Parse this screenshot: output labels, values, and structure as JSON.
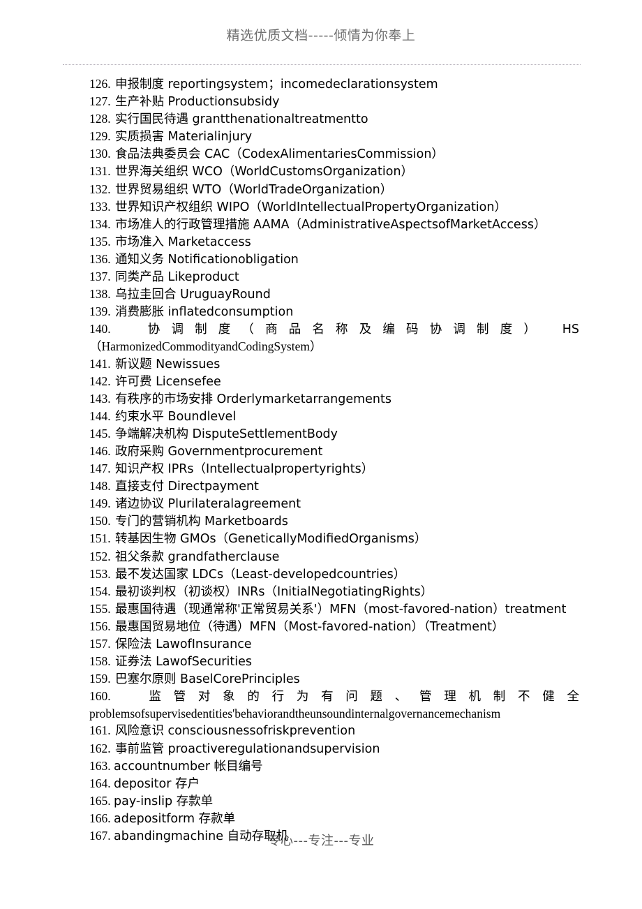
{
  "header": {
    "watermark": "精选优质文档-----倾情为你奉上"
  },
  "footer": {
    "watermark": "专心---专注---专业"
  },
  "glossary": {
    "items": [
      {
        "num": "126.",
        "text": "申报制度 reportingsystem；incomedeclarationsystem",
        "layout": "simple"
      },
      {
        "num": "127.",
        "text": "生产补贴 Productionsubsidy",
        "layout": "simple"
      },
      {
        "num": "128.",
        "text": "实行国民待遇 grantthenationaltreatmentto",
        "layout": "simple"
      },
      {
        "num": "129.",
        "text": "实质损害 Materialinjury",
        "layout": "simple"
      },
      {
        "num": "130.",
        "text": "食品法典委员会 CAC（CodexAlimentariesCommission）",
        "layout": "simple"
      },
      {
        "num": "131.",
        "text": "世界海关组织 WCO（WorldCustomsOrganization）",
        "layout": "simple"
      },
      {
        "num": "132.",
        "text": "世界贸易组织 WTO（WorldTradeOrganization）",
        "layout": "simple"
      },
      {
        "num": "133.",
        "text": "世界知识产权组织 WIPO（WorldIntellectualPropertyOrganization）",
        "layout": "simple"
      },
      {
        "num": "134.",
        "text": "市场准人的行政管理措施 AAMA（AdministrativeAspectsofMarketAccess）",
        "layout": "simple"
      },
      {
        "num": "135.",
        "text": "市场准入 Marketaccess",
        "layout": "simple"
      },
      {
        "num": "136.",
        "text": "通知义务 Notificationobligation",
        "layout": "simple"
      },
      {
        "num": "137.",
        "text": "同类产品 Likeproduct",
        "layout": "simple"
      },
      {
        "num": "138.",
        "text": "乌拉圭回合 UruguayRound",
        "layout": "simple"
      },
      {
        "num": "139.",
        "text": "消费膨胀 inflatedconsumption",
        "layout": "simple"
      },
      {
        "num": "140.",
        "layout": "justified",
        "line1": "协调制度（商品名称及编码协调制度） HS",
        "line2": "（HarmonizedCommodityandCodingSystem）"
      },
      {
        "num": "141.",
        "text": "新议题 Newissues",
        "layout": "simple"
      },
      {
        "num": "142.",
        "text": "许可费  Licensefee",
        "layout": "simple"
      },
      {
        "num": "143.",
        "text": "有秩序的市场安排 Orderlymarketarrangements",
        "layout": "simple"
      },
      {
        "num": "144.",
        "text": "约束水平 Boundlevel",
        "layout": "simple"
      },
      {
        "num": "145.",
        "text": "争端解决机构 DisputeSettlementBody",
        "layout": "simple"
      },
      {
        "num": "146.",
        "text": "政府采购 Governmentprocurement",
        "layout": "simple"
      },
      {
        "num": "147.",
        "text": "知识产权 IPRs（Intellectualpropertyrights）",
        "layout": "simple"
      },
      {
        "num": "148.",
        "text": "直接支付 Directpayment",
        "layout": "simple"
      },
      {
        "num": "149.",
        "text": "诸边协议 Plurilateralagreement",
        "layout": "simple"
      },
      {
        "num": "150.",
        "text": "专门的营销机构 Marketboards",
        "layout": "simple"
      },
      {
        "num": "151.",
        "text": "转基因生物 GMOs（GeneticallyModifiedOrganisms）",
        "layout": "simple"
      },
      {
        "num": "152.",
        "text": "祖父条款 grandfatherclause",
        "layout": "simple"
      },
      {
        "num": "153.",
        "text": "最不发达国家 LDCs（Least-developedcountries）",
        "layout": "simple"
      },
      {
        "num": "154.",
        "text": "最初谈判权（初谈权）INRs（InitialNegotiatingRights）",
        "layout": "simple"
      },
      {
        "num": "155.",
        "text": "最惠国待遇（现通常称'正常贸易关系'）MFN（most-favored-nation）treatment",
        "layout": "simple"
      },
      {
        "num": "156.",
        "text": "最惠国贸易地位（待遇）MFN（Most-favored-nation）（Treatment）",
        "layout": "simple"
      },
      {
        "num": "157.",
        "text": "保险法 LawofInsurance",
        "layout": "simple"
      },
      {
        "num": "158.",
        "text": "证券法 LawofSecurities",
        "layout": "simple"
      },
      {
        "num": "159.",
        "text": "巴塞尔原则 BaselCorePrinciples",
        "layout": "simple"
      },
      {
        "num": "160.",
        "layout": "justified",
        "line1": "监管对象的行为有问题、管理机制不健全",
        "line2": "problemsofsupervisedentities'behaviorandtheunsoundinternalgovernancemechanism"
      },
      {
        "num": "161.",
        "text": "风险意识 consciousnessofriskprevention",
        "layout": "simple"
      },
      {
        "num": "162.",
        "text": "事前监管 proactiveregulationandsupervision",
        "layout": "simple"
      },
      {
        "num": "163.",
        "text": "accountnumber 帐目编号",
        "layout": "latin-first"
      },
      {
        "num": "164.",
        "text": "depositor 存户",
        "layout": "latin-first"
      },
      {
        "num": "165.",
        "text": "pay-inslip 存款单",
        "layout": "latin-first"
      },
      {
        "num": "166.",
        "text": "adepositform 存款单",
        "layout": "latin-first"
      },
      {
        "num": "167.",
        "text": "abandingmachine 自动存取机",
        "layout": "latin-first"
      }
    ]
  }
}
